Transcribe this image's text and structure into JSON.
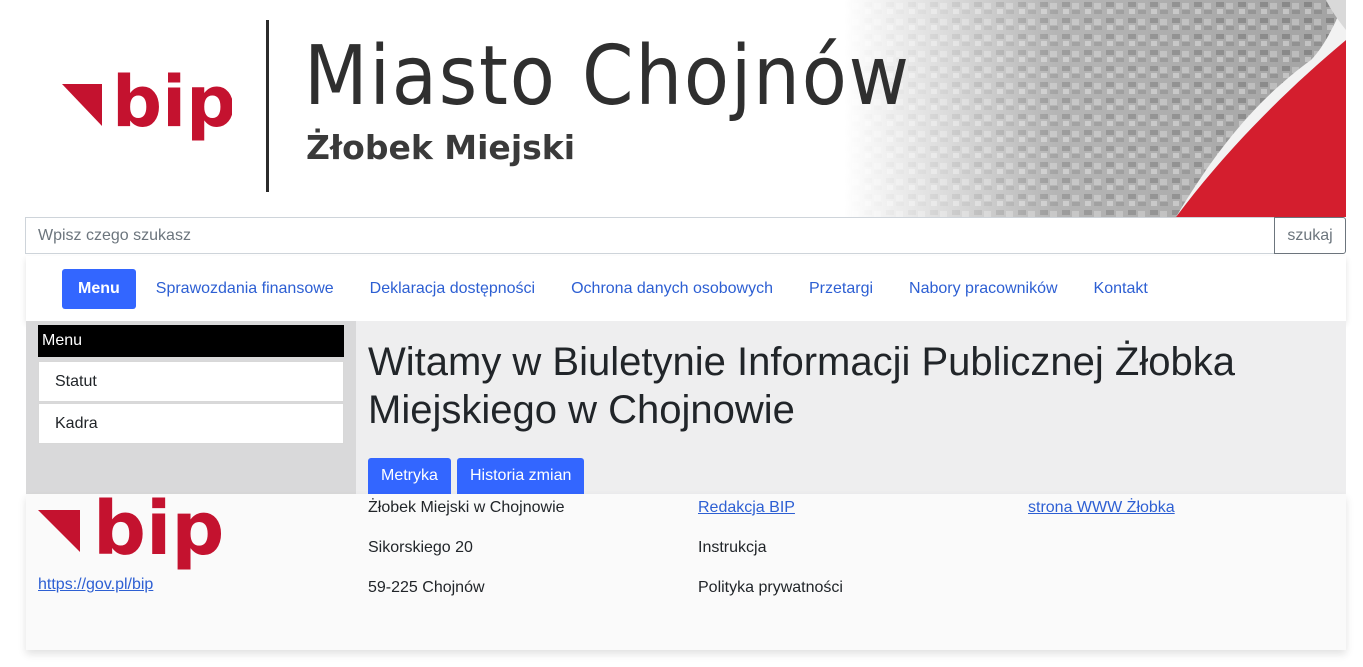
{
  "header": {
    "logo_text": "bip",
    "city": "Miasto Chojnów",
    "institution": "Żłobek Miejski"
  },
  "search": {
    "placeholder": "Wpisz czego szukasz",
    "button_label": "szukaj"
  },
  "nav": {
    "menu_label": "Menu",
    "links": [
      "Sprawozdania finansowe",
      "Deklaracja dostępności",
      "Ochrona danych osobowych",
      "Przetargi",
      "Nabory pracowników",
      "Kontakt"
    ]
  },
  "sidebar": {
    "heading": "Menu",
    "items": [
      "Statut",
      "Kadra"
    ]
  },
  "main": {
    "title": "Witamy w Biuletynie Informacji Publicznej Żłobka Miejskiego w Chojnowie",
    "buttons": [
      "Metryka",
      "Historia zmian"
    ]
  },
  "footer": {
    "bip_link": "https://gov.pl/bip",
    "address": [
      "Żłobek Miejski w Chojnowie",
      "Sikorskiego 20",
      "59-225 Chojnów"
    ],
    "col2_link": "Redakcja BIP",
    "col2_items": [
      "Instrukcja",
      "Polityka prywatności"
    ],
    "col3_link": "strona WWW Żłobka"
  },
  "colors": {
    "accent": "#3366ff",
    "link": "#2d5fd3",
    "bip_red": "#c4122f"
  }
}
